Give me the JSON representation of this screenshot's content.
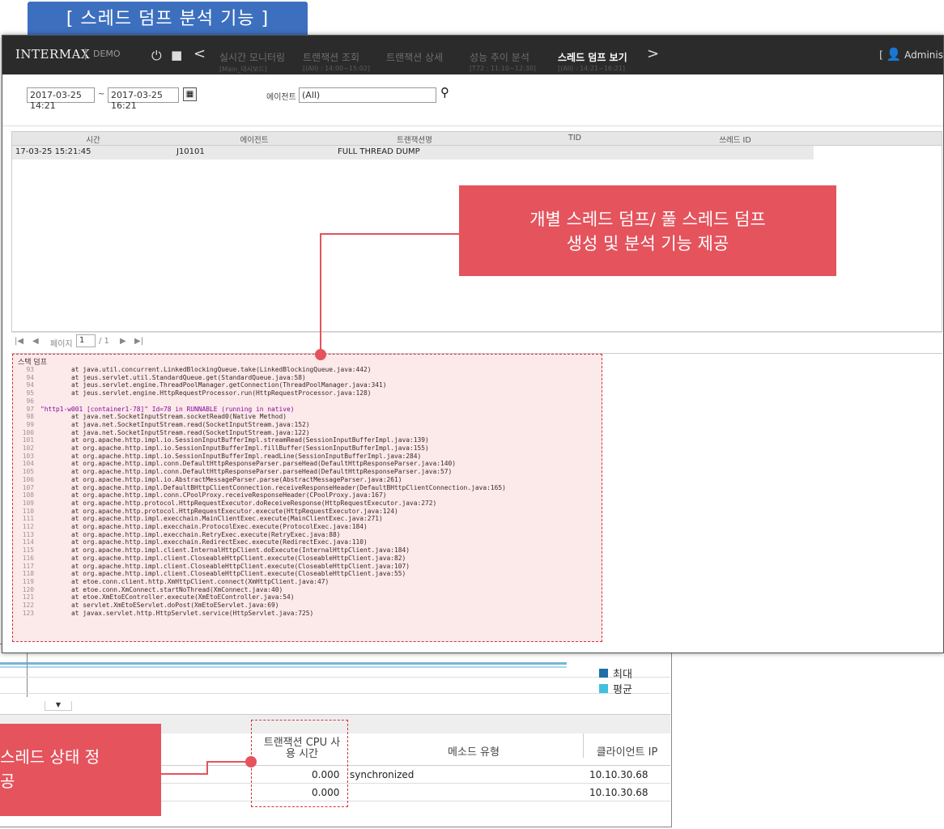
{
  "title_tab": "[ 스레드 덤프 분석 기능 ]",
  "app": {
    "logo": "INTERMAX",
    "edition": "DEMO",
    "admin_label": "Adminis",
    "admin_bracket": "["
  },
  "nav": {
    "items": [
      {
        "label": "실시간 모니터링",
        "sub": "[Main_대시보드]"
      },
      {
        "label": "트랜잭션 조회",
        "sub": "[(All) : 14:00~15:02]"
      },
      {
        "label": "트랜잭션 상세",
        "sub": ""
      },
      {
        "label": "성능 추이 분석",
        "sub": "[T72 : 11:10~12:30]"
      },
      {
        "label": "스레드 덤프 보기",
        "sub": "[(All) : 14:21~16:21]"
      }
    ]
  },
  "filter": {
    "date_from": "2017-03-25 14:21",
    "tilde": "~",
    "date_to": "2017-03-25 16:21",
    "agent_label": "에이전트",
    "agent_value": "(All)"
  },
  "grid": {
    "columns": [
      "시간",
      "에이전트",
      "트랜잭션명",
      "TID",
      "쓰레드 ID"
    ],
    "rows": [
      {
        "time": "17-03-25 15:21:45",
        "agent": "J10101",
        "txn": "FULL THREAD DUMP",
        "tid": "",
        "thread": ""
      }
    ]
  },
  "pager": {
    "page_label": "페이지",
    "page_value": "1",
    "total": "/ 1"
  },
  "stack": {
    "title": "스택 덤프",
    "lines": [
      {
        "n": "93",
        "t": "        at java.util.concurrent.LinkedBlockingQueue.take(LinkedBlockingQueue.java:442)"
      },
      {
        "n": "94",
        "t": "        at jeus.servlet.util.StandardQueue.get(StandardQueue.java:58)"
      },
      {
        "n": "94",
        "t": "        at jeus.servlet.engine.ThreadPoolManager.getConnection(ThreadPoolManager.java:341)"
      },
      {
        "n": "95",
        "t": "        at jeus.servlet.engine.HttpRequestProcessor.run(HttpRequestProcessor.java:128)"
      },
      {
        "n": "96",
        "t": ""
      },
      {
        "n": "97",
        "t": "\"http1-w001 [container1-78]\" Id=78 in RUNNABLE (running in native)"
      },
      {
        "n": "98",
        "t": "        at java.net.SocketInputStream.socketRead0(Native Method)"
      },
      {
        "n": "99",
        "t": "        at java.net.SocketInputStream.read(SocketInputStream.java:152)"
      },
      {
        "n": "100",
        "t": "        at java.net.SocketInputStream.read(SocketInputStream.java:122)"
      },
      {
        "n": "101",
        "t": "        at org.apache.http.impl.io.SessionInputBufferImpl.streamRead(SessionInputBufferImpl.java:139)"
      },
      {
        "n": "102",
        "t": "        at org.apache.http.impl.io.SessionInputBufferImpl.fillBuffer(SessionInputBufferImpl.java:155)"
      },
      {
        "n": "103",
        "t": "        at org.apache.http.impl.io.SessionInputBufferImpl.readLine(SessionInputBufferImpl.java:284)"
      },
      {
        "n": "104",
        "t": "        at org.apache.http.impl.conn.DefaultHttpResponseParser.parseHead(DefaultHttpResponseParser.java:140)"
      },
      {
        "n": "105",
        "t": "        at org.apache.http.impl.conn.DefaultHttpResponseParser.parseHead(DefaultHttpResponseParser.java:57)"
      },
      {
        "n": "106",
        "t": "        at org.apache.http.impl.io.AbstractMessageParser.parse(AbstractMessageParser.java:261)"
      },
      {
        "n": "107",
        "t": "        at org.apache.http.impl.DefaultBHttpClientConnection.receiveResponseHeader(DefaultBHttpClientConnection.java:165)"
      },
      {
        "n": "108",
        "t": "        at org.apache.http.impl.conn.CPoolProxy.receiveResponseHeader(CPoolProxy.java:167)"
      },
      {
        "n": "109",
        "t": "        at org.apache.http.protocol.HttpRequestExecutor.doReceiveResponse(HttpRequestExecutor.java:272)"
      },
      {
        "n": "110",
        "t": "        at org.apache.http.protocol.HttpRequestExecutor.execute(HttpRequestExecutor.java:124)"
      },
      {
        "n": "111",
        "t": "        at org.apache.http.impl.execchain.MainClientExec.execute(MainClientExec.java:271)"
      },
      {
        "n": "112",
        "t": "        at org.apache.http.impl.execchain.ProtocolExec.execute(ProtocolExec.java:184)"
      },
      {
        "n": "113",
        "t": "        at org.apache.http.impl.execchain.RetryExec.execute(RetryExec.java:88)"
      },
      {
        "n": "114",
        "t": "        at org.apache.http.impl.execchain.RedirectExec.execute(RedirectExec.java:110)"
      },
      {
        "n": "115",
        "t": "        at org.apache.http.impl.client.InternalHttpClient.doExecute(InternalHttpClient.java:184)"
      },
      {
        "n": "116",
        "t": "        at org.apache.http.impl.client.CloseableHttpClient.execute(CloseableHttpClient.java:82)"
      },
      {
        "n": "117",
        "t": "        at org.apache.http.impl.client.CloseableHttpClient.execute(CloseableHttpClient.java:107)"
      },
      {
        "n": "118",
        "t": "        at org.apache.http.impl.client.CloseableHttpClient.execute(CloseableHttpClient.java:55)"
      },
      {
        "n": "119",
        "t": "        at etoe.conn.client.http.XmHttpClient.connect(XmHttpClient.java:47)"
      },
      {
        "n": "120",
        "t": "        at etoe.conn.XmConnect.startNoThread(XmConnect.java:40)"
      },
      {
        "n": "121",
        "t": "        at etoe.XmEtoEController.execute(XmEtoEController.java:54)"
      },
      {
        "n": "122",
        "t": "        at servlet.XmEtoEServlet.doPost(XmEtoEServlet.java:69)"
      },
      {
        "n": "123",
        "t": "        at javax.servlet.http.HttpServlet.service(HttpServlet.java:725)"
      }
    ]
  },
  "callout_top": {
    "line1": "개별 스레드 덤프/ 풀 스레드 덤프",
    "line2": "생성 및 분석 기능 제공"
  },
  "callout_bottom": {
    "line1": "스레드 상태 정",
    "line2": "공"
  },
  "back_panel": {
    "legend": [
      {
        "label": "최대",
        "color": "#1e6fa8"
      },
      {
        "label": "평균",
        "color": "#3fc0e0"
      }
    ],
    "columns": [
      "트랜잭션 CPU 사용 시간",
      "메소드 유형",
      "클라이언트 IP"
    ],
    "cpu_col_line1": "트랜잭션 CPU 사",
    "cpu_col_line2": "용 시간",
    "rows": [
      {
        "cpu": "0.000",
        "method": "synchronized",
        "ip": "10.10.30.68"
      },
      {
        "cpu": "0.000",
        "method": "",
        "ip": "10.10.30.68"
      }
    ]
  },
  "colors": {
    "accent_red": "#e5535d",
    "title_blue": "#3d6fbf",
    "topbar": "#2b2b2b"
  }
}
